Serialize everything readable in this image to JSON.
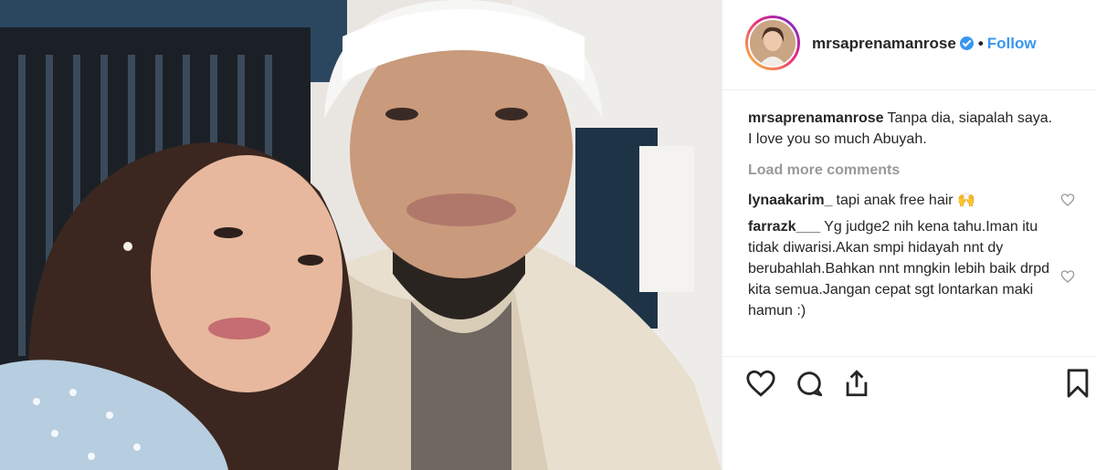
{
  "header": {
    "username": "mrsaprenamanrose",
    "dot": "•",
    "follow_label": "Follow"
  },
  "caption": {
    "username": "mrsaprenamanrose",
    "text": "Tanpa dia, siapalah saya. I love you so much Abuyah."
  },
  "load_more_label": "Load more comments",
  "comments": [
    {
      "username": "lynaakarim_",
      "text": "tapi anak free hair 🙌"
    },
    {
      "username": "farrazk___",
      "text": "Yg judge2 nih kena tahu.Iman itu tidak diwarisi.Akan smpi hidayah nnt dy berubahlah.Bahkan nnt mngkin lebih baik drpd kita semua.Jangan cepat sgt lontarkan maki hamun :)"
    }
  ],
  "icons": {
    "verified": "verified-badge-icon",
    "like": "heart-icon",
    "comment": "comment-icon",
    "share": "share-icon",
    "save": "bookmark-icon"
  },
  "colors": {
    "link_blue": "#3897f0",
    "muted": "#999999",
    "text": "#262626"
  }
}
